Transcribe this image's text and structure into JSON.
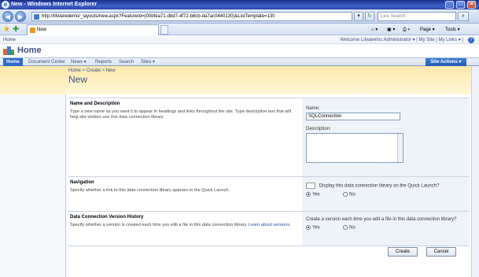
{
  "browser": {
    "window_title": "New - Windows Internet Explorer",
    "address": "http://litwaredemo/_layouts/new.aspx?FeatureId={00bfea71-dbd7-4f72-b8cb-da7ac0440130}&ListTemplate=130",
    "search_placeholder": "Live Search",
    "tab_label": "New",
    "commands": {
      "page": "Page ▾",
      "tools": "Tools ▾"
    }
  },
  "sharepoint": {
    "site_label": "Home",
    "welcome": "Welcome LitwareInc Administrator ▾",
    "my_site": "My Site",
    "my_links": "My Links ▾",
    "title": "Home",
    "nav": [
      {
        "label": "Home"
      },
      {
        "label": "Document Center"
      },
      {
        "label": "News ▾"
      },
      {
        "label": "Reports"
      },
      {
        "label": "Search"
      },
      {
        "label": "Sites ▾"
      }
    ],
    "site_actions": "Site Actions ▾"
  },
  "page": {
    "breadcrumb": "Home > Create > New",
    "title": "New"
  },
  "form": {
    "name_desc": {
      "heading": "Name and Description",
      "help": "Type a new name as you want it to appear in headings and links throughout the site. Type descriptive text that will help site visitors use this data connection library.",
      "name_label": "Name:",
      "name_value": "SQLConnection",
      "description_label": "Description:",
      "description_value": ""
    },
    "navigation": {
      "heading": "Navigation",
      "help": "Specify whether a link to this data connection library appears in the Quick Launch.",
      "question": "Display this data connection library on the Quick Launch?",
      "yes": "Yes",
      "no": "No",
      "selected": "Yes"
    },
    "versioning": {
      "heading": "Data Connection Version History",
      "help": "Specify whether a version is created each time you edit a file in this data connection library.",
      "learn_more": "Learn about versions.",
      "question": "Create a version each time you edit a file in this data connection library?",
      "yes": "Yes",
      "no": "No",
      "selected": "Yes"
    },
    "create_label": "Create",
    "cancel_label": "Cancel"
  },
  "colors": {
    "title_bar": "#2a46a8",
    "sharepoint_blue": "#3b4f81",
    "site_actions": "#215bb4",
    "title_band": "#fde9ac"
  }
}
